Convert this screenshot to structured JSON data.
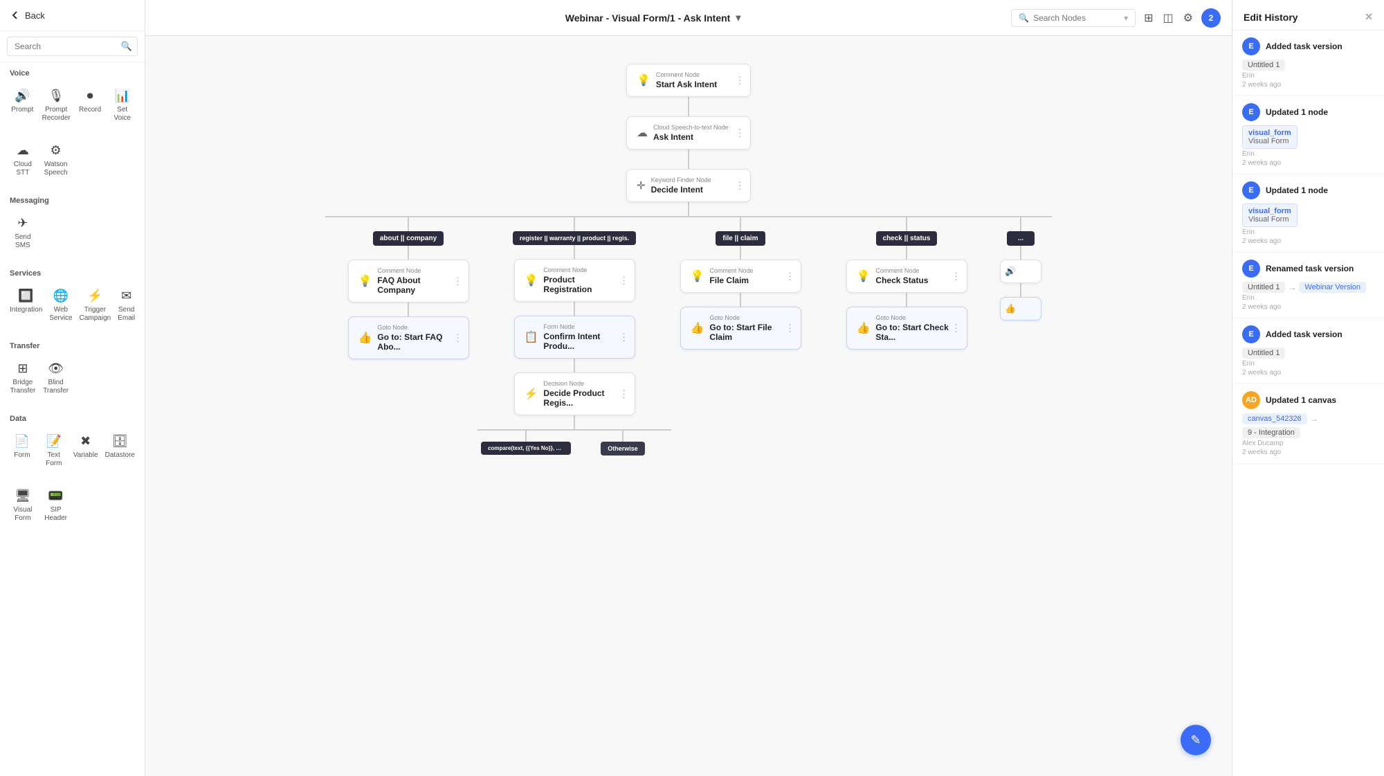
{
  "sidebar": {
    "back_label": "Back",
    "search_placeholder": "Search",
    "sections": [
      {
        "title": "Voice",
        "items": [
          {
            "id": "prompt",
            "label": "Prompt",
            "icon": "🔊"
          },
          {
            "id": "prompt-recorder",
            "label": "Prompt Recorder",
            "icon": "🎙"
          },
          {
            "id": "record",
            "label": "Record",
            "icon": "⏺"
          },
          {
            "id": "set-voice",
            "label": "Set Voice",
            "icon": "📊"
          }
        ]
      },
      {
        "title": "",
        "items": [
          {
            "id": "cloud-stt",
            "label": "Cloud STT",
            "icon": "☁"
          },
          {
            "id": "watson-speech",
            "label": "Watson Speech",
            "icon": "⚙"
          }
        ]
      },
      {
        "title": "Messaging",
        "items": [
          {
            "id": "send-sms",
            "label": "Send SMS",
            "icon": "✈"
          },
          {
            "id": "msg2",
            "label": "",
            "icon": ""
          },
          {
            "id": "msg3",
            "label": "",
            "icon": ""
          },
          {
            "id": "msg4",
            "label": "",
            "icon": ""
          }
        ]
      },
      {
        "title": "Services",
        "items": [
          {
            "id": "integration",
            "label": "Integration",
            "icon": "🔲"
          },
          {
            "id": "web-service",
            "label": "Web Service",
            "icon": "🌐"
          },
          {
            "id": "trigger-campaign",
            "label": "Trigger Campaign",
            "icon": "⚡"
          },
          {
            "id": "send-email",
            "label": "Send Email",
            "icon": "✉"
          }
        ]
      },
      {
        "title": "Transfer",
        "items": [
          {
            "id": "bridge-transfer",
            "label": "Bridge Transfer",
            "icon": "⊞"
          },
          {
            "id": "blind-transfer",
            "label": "Blind Transfer",
            "icon": "👁"
          }
        ]
      },
      {
        "title": "Data",
        "items": [
          {
            "id": "form",
            "label": "Form",
            "icon": "📄"
          },
          {
            "id": "text-form",
            "label": "Text Form",
            "icon": "📝"
          },
          {
            "id": "variable",
            "label": "Variable",
            "icon": "✖"
          },
          {
            "id": "datastore",
            "label": "Datastore",
            "icon": "🗄"
          }
        ]
      },
      {
        "title": "",
        "items": [
          {
            "id": "visual-form",
            "label": "Visual Form",
            "icon": "🖥"
          },
          {
            "id": "sip-header",
            "label": "SIP Header",
            "icon": "📟"
          }
        ]
      }
    ]
  },
  "topbar": {
    "title": "Webinar - Visual Form/1 - Ask Intent",
    "search_placeholder": "Search Nodes",
    "badge_count": "2"
  },
  "canvas": {
    "nodes": {
      "start": {
        "type": "Comment Node",
        "label": "Start Ask Intent",
        "icon": "bulb"
      },
      "ask_intent": {
        "type": "Cloud Speech-to-text Node",
        "label": "Ask Intent",
        "icon": "cloud"
      },
      "decide_intent": {
        "type": "Keyword Finder Node",
        "label": "Decide Intent",
        "icon": "cursor"
      },
      "branches": [
        {
          "condition": "about || company",
          "comment_type": "Comment Node",
          "comment_label": "FAQ About Company",
          "goto_type": "Goto Node",
          "goto_label": "Go to: Start FAQ Abo..."
        },
        {
          "condition": "register || warranty || product || regis.",
          "comment_type": "Comment Node",
          "comment_label": "Product Registration",
          "goto_type": "Form Node",
          "goto_label": "Confirm Intent Produ..."
        },
        {
          "condition": "file || claim",
          "comment_type": "Comment Node",
          "comment_label": "File Claim",
          "goto_type": "Goto Node",
          "goto_label": "Go to: Start File Claim"
        },
        {
          "condition": "check || status",
          "comment_type": "Comment Node",
          "comment_label": "Check Status",
          "goto_type": "Goto Node",
          "goto_label": "Go to: Start Check Sta..."
        },
        {
          "condition": "...",
          "comment_type": "Comment Node",
          "comment_label": "",
          "goto_type": "Goto Node",
          "goto_label": ""
        }
      ],
      "decision": {
        "type": "Decision Node",
        "label": "Decide Product Regis..."
      },
      "conditions": [
        {
          "label": "compare(text, {{Yes No}}, ==, yes)"
        },
        {
          "label": "Otherwise"
        }
      ]
    }
  },
  "right_panel": {
    "title": "Edit History",
    "items": [
      {
        "avatar": "E",
        "avatar_color": "blue",
        "action": "Added task version",
        "tags": [
          {
            "text": "Untitled 1",
            "type": "gray"
          }
        ],
        "time": "2 weeks ago",
        "user": "Erin"
      },
      {
        "avatar": "E",
        "avatar_color": "blue",
        "action": "Updated 1 node",
        "tags": [
          {
            "text": "visual_form",
            "type": "blue"
          },
          {
            "text": "Visual Form",
            "subtext": true
          }
        ],
        "time": "2 weeks ago",
        "user": "Erin"
      },
      {
        "avatar": "E",
        "avatar_color": "blue",
        "action": "Updated 1 node",
        "tags": [
          {
            "text": "visual_form",
            "type": "blue"
          },
          {
            "text": "Visual Form",
            "subtext": true
          }
        ],
        "time": "2 weeks ago",
        "user": "Erin"
      },
      {
        "avatar": "E",
        "avatar_color": "blue",
        "action": "Renamed task version",
        "tags": [
          {
            "text": "Untitled 1",
            "type": "gray"
          },
          {
            "text": "→",
            "arrow": true
          },
          {
            "text": "Webinar Version",
            "type": "blue"
          }
        ],
        "time": "2 weeks ago",
        "user": "Erin"
      },
      {
        "avatar": "E",
        "avatar_color": "blue",
        "action": "Added task version",
        "tags": [
          {
            "text": "Untitled 1",
            "type": "gray"
          }
        ],
        "time": "2 weeks ago",
        "user": "Erin"
      },
      {
        "avatar": "AD",
        "avatar_color": "yellow",
        "action": "Updated 1 canvas",
        "tags": [
          {
            "text": "canvas_542326",
            "type": "blue"
          },
          {
            "text": "→",
            "arrow": true
          },
          {
            "text": "9 - Integration",
            "type": "gray"
          }
        ],
        "time": "2 weeks ago",
        "user": "Alex Ducamp"
      }
    ]
  },
  "fab": {
    "icon": "✎"
  }
}
